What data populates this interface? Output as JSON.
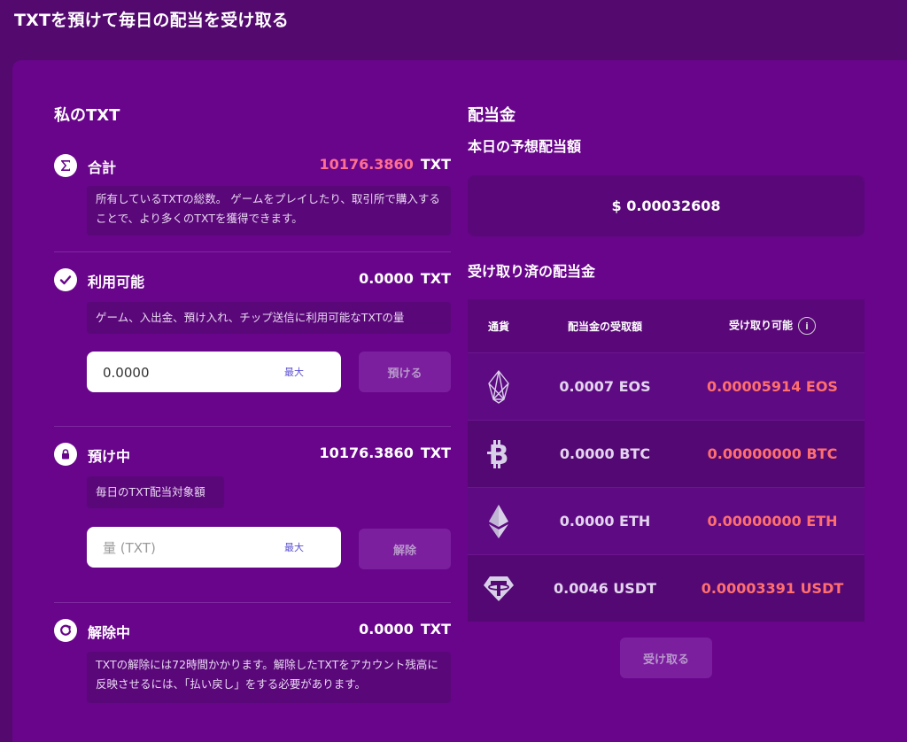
{
  "page": {
    "title": "TXTを預けて毎日の配当を受け取る"
  },
  "my_txt": {
    "heading": "私のTXT",
    "total": {
      "label": "合計",
      "amount": "10176.3860",
      "unit": "TXT",
      "description": "所有しているTXTの総数。 ゲームをプレイしたり、取引所で購入することで、より多くのTXTを獲得できます。"
    },
    "available": {
      "label": "利用可能",
      "amount": "0.0000",
      "unit": "TXT",
      "description": "ゲーム、入出金、預け入れ、チップ送信に利用可能なTXTの量",
      "input_value": "0.0000",
      "max_label": "最大",
      "button_label": "預ける"
    },
    "staked": {
      "label": "預け中",
      "amount": "10176.3860",
      "unit": "TXT",
      "description": "毎日のTXT配当対象額",
      "input_placeholder": "量 (TXT)",
      "max_label": "最大",
      "button_label": "解除"
    },
    "unstaking": {
      "label": "解除中",
      "amount": "0.0000",
      "unit": "TXT",
      "description": "TXTの解除には72時間かかります。解除したTXTをアカウント残高に反映させるには、「払い戻し」をする必要があります。"
    }
  },
  "dividends": {
    "heading": "配当金",
    "estimate_heading": "本日の予想配当額",
    "estimate_value": "$ 0.00032608",
    "received_heading": "受け取り済の配当金",
    "columns": {
      "currency": "通貨",
      "received": "配当金の受取額",
      "claimable": "受け取り可能"
    },
    "rows": [
      {
        "icon": "eos-icon",
        "received": "0.0007 EOS",
        "claimable": "0.00005914 EOS"
      },
      {
        "icon": "btc-icon",
        "received": "0.0000 BTC",
        "claimable": "0.00000000 BTC"
      },
      {
        "icon": "eth-icon",
        "received": "0.0000 ETH",
        "claimable": "0.00000000 ETH"
      },
      {
        "icon": "usdt-icon",
        "received": "0.0046 USDT",
        "claimable": "0.00003391 USDT"
      }
    ],
    "claim_button": "受け取る"
  },
  "colors": {
    "background": "#54096f",
    "panel": "#68058b",
    "accent_pink": "#ff6f91"
  }
}
